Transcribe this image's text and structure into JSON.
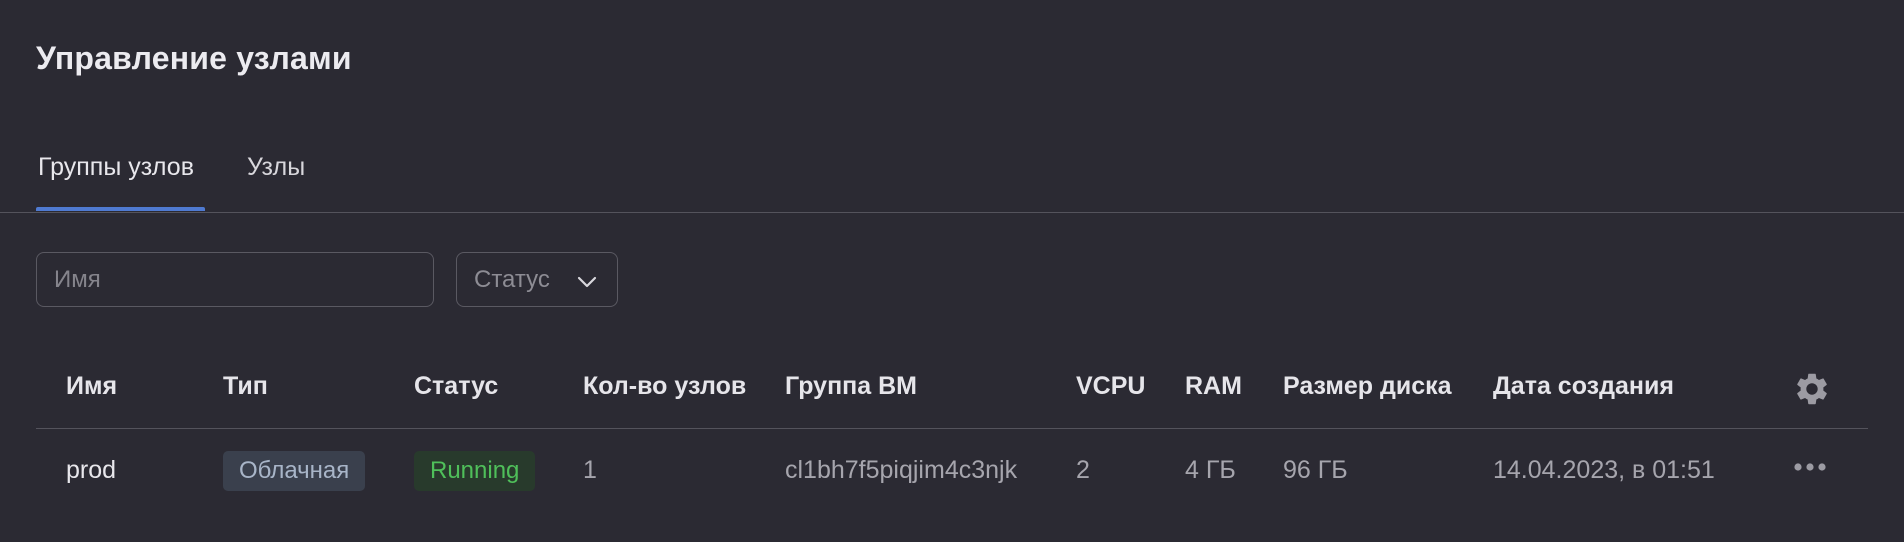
{
  "header": {
    "title": "Управление узлами"
  },
  "tabs": [
    {
      "label": "Группы узлов",
      "active": true
    },
    {
      "label": "Узлы",
      "active": false
    }
  ],
  "filters": {
    "name_placeholder": "Имя",
    "status_label": "Статус"
  },
  "table": {
    "columns": [
      "Имя",
      "Тип",
      "Статус",
      "Кол-во узлов",
      "Группа ВМ",
      "VCPU",
      "RAM",
      "Размер диска",
      "Дата создания"
    ],
    "rows": [
      {
        "name": "prod",
        "type": "Облачная",
        "status": "Running",
        "node_count": "1",
        "vm_group": "cl1bh7f5piqjim4c3njk",
        "vcpu": "2",
        "ram": "4 ГБ",
        "disk": "96 ГБ",
        "created": "14.04.2023, в 01:51"
      }
    ]
  },
  "icons": {
    "settings": "gear-icon",
    "dropdown": "chevron-down-icon",
    "row_actions": "more-horizontal-icon"
  },
  "colors": {
    "background": "#2b2a33",
    "accent": "#4f7ad1",
    "status_running": "#4fbf5a"
  }
}
